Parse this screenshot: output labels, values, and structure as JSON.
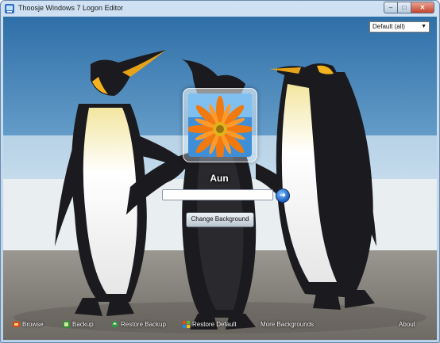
{
  "window": {
    "title": "Thoosje Windows 7 Logon Editor"
  },
  "controls": {
    "minimize": "–",
    "maximize": "□",
    "close": "✕"
  },
  "dropdown": {
    "selected": "Default (all)"
  },
  "login": {
    "username": "Aun",
    "password_placeholder": "",
    "change_background": "Change Background"
  },
  "bottom": {
    "browse": "Browse",
    "backup": "Backup",
    "restore_backup": "Restore Backup",
    "restore_default": "Restore Default",
    "more_backgrounds": "More Backgrounds",
    "about": "About"
  },
  "icons": {
    "browse": "folder-image-icon",
    "backup": "backup-icon",
    "restore_backup": "restore-icon",
    "restore_default": "windows-restore-icon"
  }
}
